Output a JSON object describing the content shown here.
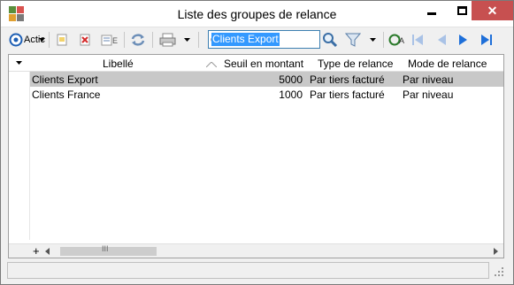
{
  "window": {
    "title": "Liste des groupes de relance",
    "close_glyph": "✕"
  },
  "toolbar": {
    "actions_label": "Actic",
    "search_value": "Clients Export",
    "icons": [
      "actions-icon",
      "new-icon",
      "delete-icon",
      "properties-icon",
      "refresh-icon",
      "print-icon",
      "search-icon",
      "filter-icon",
      "auto-icon",
      "first-icon",
      "previous-icon",
      "next-icon",
      "last-icon"
    ]
  },
  "grid": {
    "columns": [
      "Libellé",
      "Seuil en montant",
      "Type de relance",
      "Mode de relance"
    ],
    "rows": [
      {
        "libelle": "Clients Export",
        "seuil": "5000",
        "type": "Par tiers facturé",
        "mode": "Par niveau",
        "selected": true
      },
      {
        "libelle": "Clients France",
        "seuil": "1000",
        "type": "Par tiers facturé",
        "mode": "Par niveau",
        "selected": false
      }
    ],
    "add_glyph": "+",
    "scroll_grip": "III"
  },
  "colors": {
    "close_button": "#c75050",
    "selection_row": "#c8c8c8",
    "search_highlight": "#3399ff",
    "nav_blue": "#1e6fd9"
  }
}
